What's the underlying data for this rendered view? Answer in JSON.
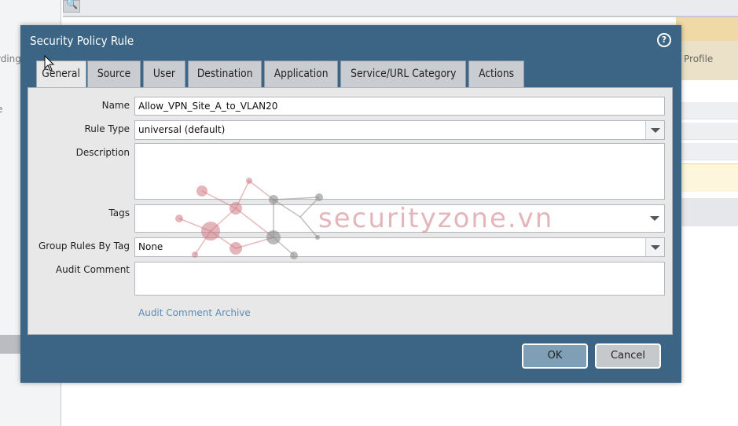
{
  "background": {
    "sidebar_texts": [
      "rding",
      "e"
    ],
    "header_right": "Profile"
  },
  "dialog": {
    "title": "Security Policy Rule",
    "help_icon": "question-circle-icon",
    "tabs": [
      {
        "label": "General",
        "active": true
      },
      {
        "label": "Source",
        "active": false
      },
      {
        "label": "User",
        "active": false
      },
      {
        "label": "Destination",
        "active": false
      },
      {
        "label": "Application",
        "active": false
      },
      {
        "label": "Service/URL Category",
        "active": false
      },
      {
        "label": "Actions",
        "active": false
      }
    ],
    "form": {
      "name_label": "Name",
      "name_value": "Allow_VPN_Site_A_to_VLAN20",
      "rule_type_label": "Rule Type",
      "rule_type_value": "universal (default)",
      "description_label": "Description",
      "description_value": "",
      "tags_label": "Tags",
      "tags_value": "",
      "group_rules_label": "Group Rules By Tag",
      "group_rules_value": "None",
      "audit_comment_label": "Audit Comment",
      "audit_comment_value": "",
      "audit_archive_link": "Audit Comment Archive"
    },
    "buttons": {
      "ok": "OK",
      "cancel": "Cancel"
    }
  },
  "watermark": {
    "text": "securityzone.vn"
  },
  "colors": {
    "dialog_frame": "#3b6485",
    "panel_bg": "#e8e8e8",
    "link": "#5b8bb5",
    "ok_button": "#7f9fb6"
  }
}
